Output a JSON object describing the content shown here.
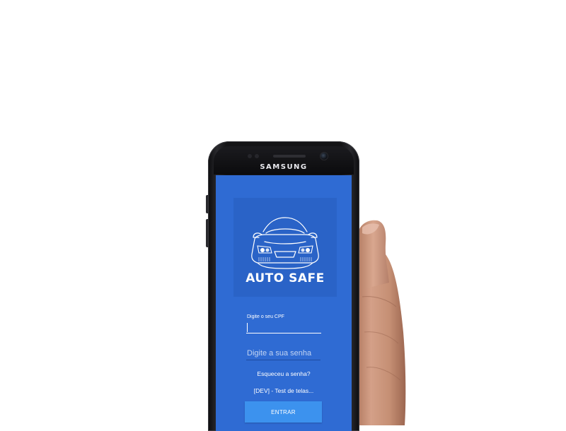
{
  "phone": {
    "brand": "SAMSUNG"
  },
  "app": {
    "logo_text": "AUTO SAFE",
    "cpf_label": "Digite o seu CPF",
    "cpf_value": "",
    "password_placeholder": "Digite a sua senha",
    "forgot_password": "Esqueceu a senha?",
    "dev_link": "[DEV] - Test de telas...",
    "enter_button": "ENTRAR"
  },
  "colors": {
    "screen_bg": "#2f6bd3",
    "logo_bg": "#2a63c7",
    "button_bg": "#3c92ee",
    "text": "#ffffff"
  },
  "icons": {
    "logo": "car-front-icon"
  }
}
